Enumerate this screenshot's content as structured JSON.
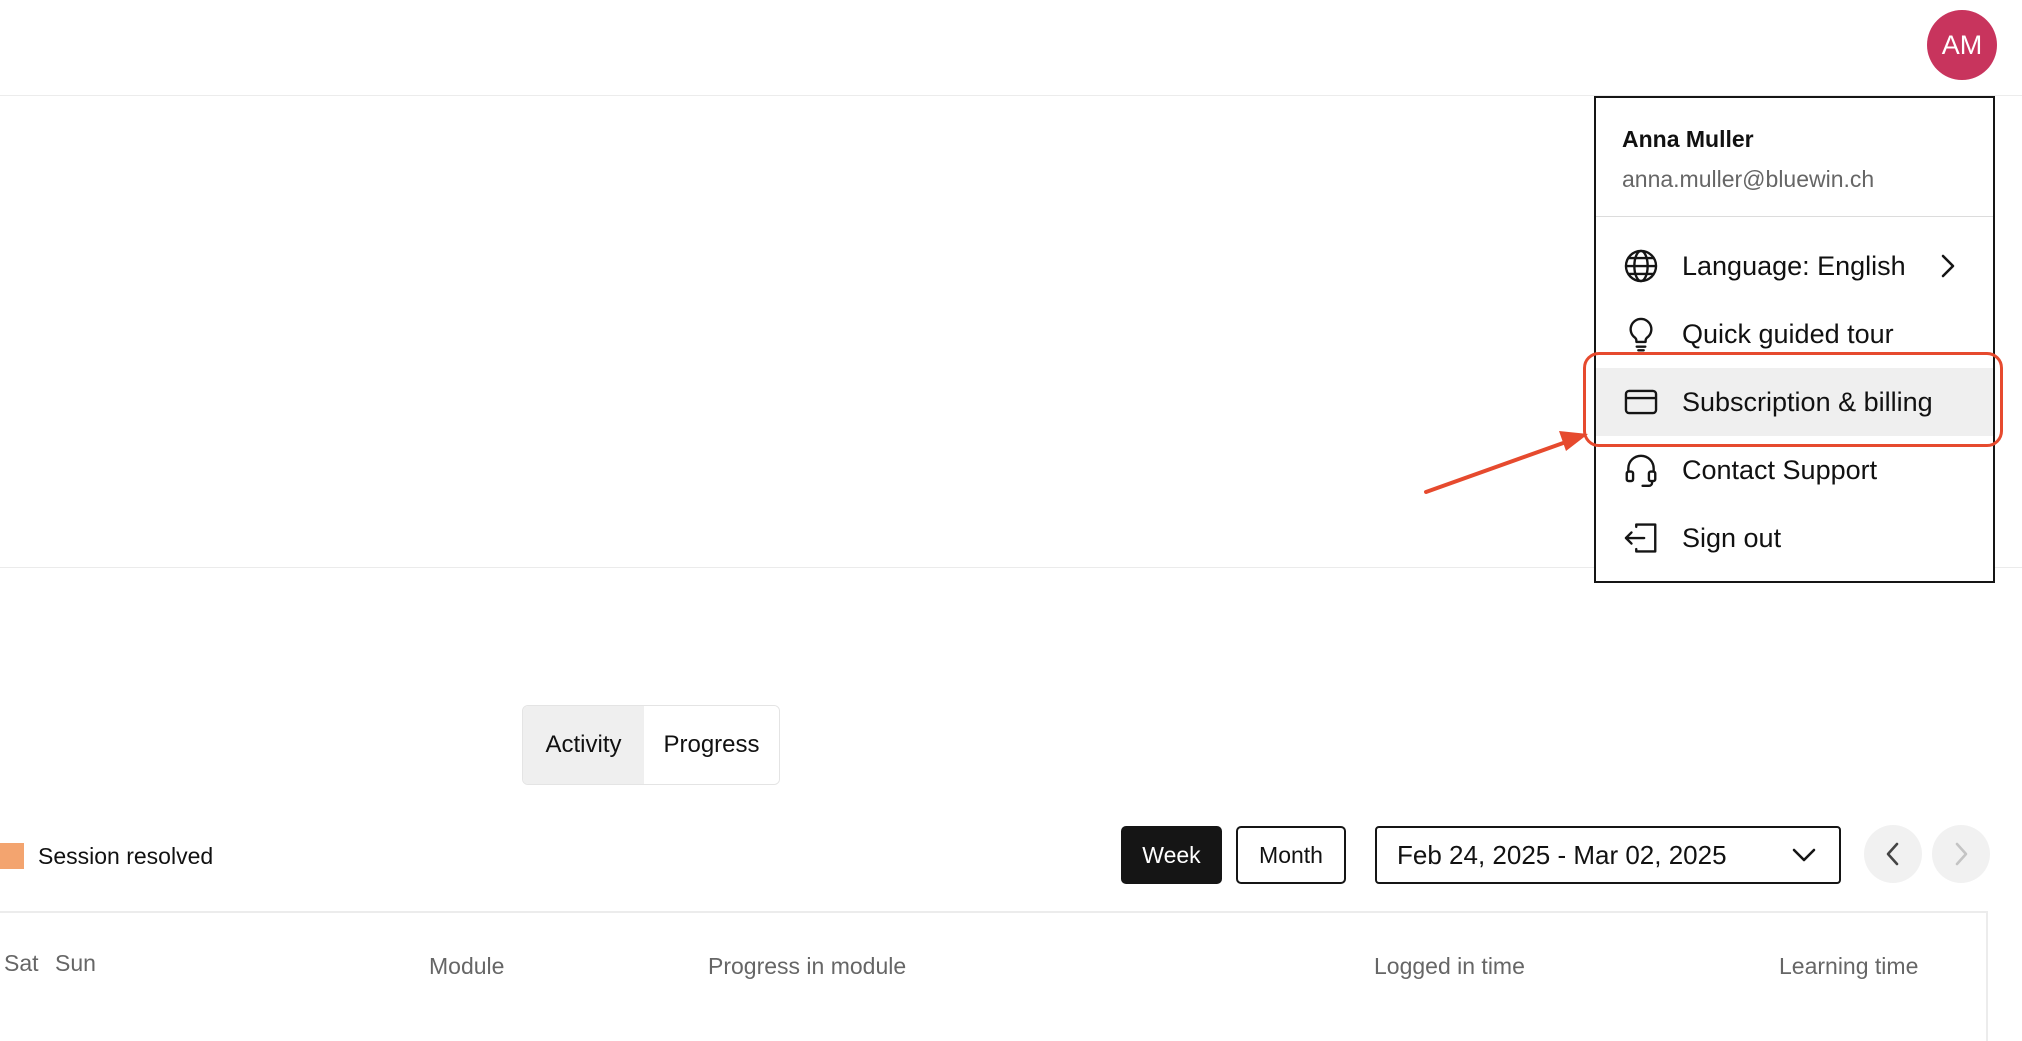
{
  "header": {
    "avatar_initials": "AM"
  },
  "user_menu": {
    "name": "Anna Muller",
    "email": "anna.muller@bluewin.ch",
    "items": [
      {
        "label": "Language: English",
        "icon": "globe-icon",
        "has_submenu": true
      },
      {
        "label": "Quick guided tour",
        "icon": "lightbulb-icon"
      },
      {
        "label": "Subscription & billing",
        "icon": "credit-card-icon",
        "highlighted": true
      },
      {
        "label": "Contact Support",
        "icon": "headset-icon"
      },
      {
        "label": "Sign out",
        "icon": "sign-out-icon"
      }
    ]
  },
  "tabs": {
    "activity": "Activity",
    "progress": "Progress",
    "selected": "Activity"
  },
  "legend": {
    "session_resolved": "Session resolved",
    "swatch_color": "#f3a46f"
  },
  "period": {
    "week": "Week",
    "month": "Month",
    "selected": "Week",
    "date_range": "Feb 24, 2025 - Mar 02, 2025"
  },
  "table": {
    "day_headers": [
      "Sat",
      "Sun"
    ],
    "columns": [
      "Module",
      "Progress in module",
      "Logged in time",
      "Learning time"
    ]
  },
  "colors": {
    "avatar": "#c8345d",
    "annotation": "#e64a2e",
    "primary_button": "#151515"
  }
}
